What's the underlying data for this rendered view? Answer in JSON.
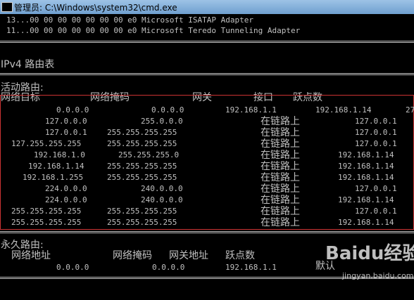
{
  "window": {
    "title": "管理员: C:\\Windows\\system32\\cmd.exe"
  },
  "interfaces": [
    "13...00 00 00 00 00 00 00 e0 Microsoft ISATAP Adapter",
    "11...00 00 00 00 00 00 00 e0 Microsoft Teredo Tunneling Adapter"
  ],
  "ipv4_title": "IPv4 路由表",
  "active_routes": {
    "title": "活动路由:",
    "headers": {
      "dest": "网络目标",
      "mask": "网络掩码",
      "gateway": "网关",
      "iface": "接口",
      "metric": "跃点数"
    },
    "rows": [
      {
        "dest": "0.0.0.0",
        "mask": "0.0.0.0",
        "gateway": "192.168.1.1",
        "iface": "192.168.1.14",
        "metric": "27"
      },
      {
        "dest": "127.0.0.0",
        "mask": "255.0.0.0",
        "gateway": "在链路上",
        "iface": "127.0.0.1",
        "metric": ""
      },
      {
        "dest": "127.0.0.1",
        "mask": "255.255.255.255",
        "gateway": "在链路上",
        "iface": "127.0.0.1",
        "metric": ""
      },
      {
        "dest": "127.255.255.255",
        "mask": "255.255.255.255",
        "gateway": "在链路上",
        "iface": "127.0.0.1",
        "metric": ""
      },
      {
        "dest": "192.168.1.0",
        "mask": "255.255.255.0",
        "gateway": "在链路上",
        "iface": "192.168.1.14",
        "metric": ""
      },
      {
        "dest": "192.168.1.14",
        "mask": "255.255.255.255",
        "gateway": "在链路上",
        "iface": "192.168.1.14",
        "metric": ""
      },
      {
        "dest": "192.168.1.255",
        "mask": "255.255.255.255",
        "gateway": "在链路上",
        "iface": "192.168.1.14",
        "metric": ""
      },
      {
        "dest": "224.0.0.0",
        "mask": "240.0.0.0",
        "gateway": "在链路上",
        "iface": "127.0.0.1",
        "metric": ""
      },
      {
        "dest": "224.0.0.0",
        "mask": "240.0.0.0",
        "gateway": "在链路上",
        "iface": "192.168.1.14",
        "metric": ""
      },
      {
        "dest": "255.255.255.255",
        "mask": "255.255.255.255",
        "gateway": "在链路上",
        "iface": "127.0.0.1",
        "metric": ""
      },
      {
        "dest": "255.255.255.255",
        "mask": "255.255.255.255",
        "gateway": "在链路上",
        "iface": "192.168.1.14",
        "metric": ""
      }
    ]
  },
  "persistent_routes": {
    "title": "永久路由:",
    "headers": {
      "addr": "网络地址",
      "mask": "网络掩码",
      "gateway": "网关地址",
      "metric": "跃点数"
    },
    "row": {
      "addr": "0.0.0.0",
      "mask": "0.0.0.0",
      "gateway": "192.168.1.1",
      "metric": "默认"
    }
  },
  "watermark": {
    "logo": "Baidu经验",
    "url": "jingyan.baidu.com"
  }
}
